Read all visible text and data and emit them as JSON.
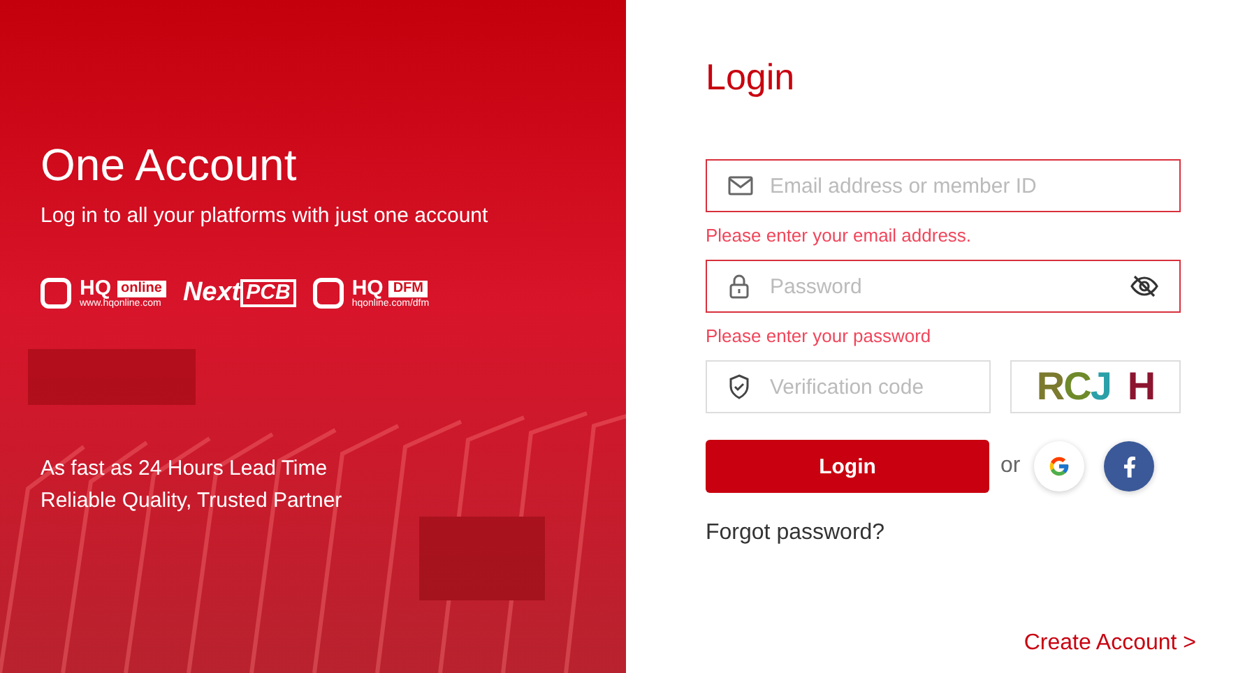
{
  "promo": {
    "title": "One Account",
    "subtitle": "Log in to all your platforms with just one account",
    "logos": [
      {
        "kind": "hq",
        "mark": "HQ",
        "tag": "online",
        "url": "www.hqonline.com"
      },
      {
        "kind": "wordmark",
        "text": "Next",
        "boxed": "PCB"
      },
      {
        "kind": "hq",
        "mark": "HQ",
        "tag": "DFM",
        "url": "hqonline.com/dfm"
      }
    ],
    "taglines": [
      "As fast as 24 Hours Lead Time",
      "Reliable Quality, Trusted Partner"
    ]
  },
  "login": {
    "title": "Login",
    "fields": [
      {
        "kind": "email",
        "placeholder": "Email address or member ID",
        "error": "Please enter your email address."
      },
      {
        "kind": "password",
        "placeholder": "Password",
        "error": "Please enter your password"
      }
    ],
    "verification": {
      "placeholder": "Verification code",
      "captcha": [
        {
          "char": "R",
          "color": "#7b7a2e"
        },
        {
          "char": "C",
          "color": "#6f8a2a"
        },
        {
          "char": "J",
          "color": "#2aa0a8"
        },
        {
          "char": "H",
          "color": "#8c1530"
        }
      ]
    },
    "submit": "Login",
    "or": "or",
    "forgot": "Forgot password?",
    "create": "Create Account >"
  }
}
